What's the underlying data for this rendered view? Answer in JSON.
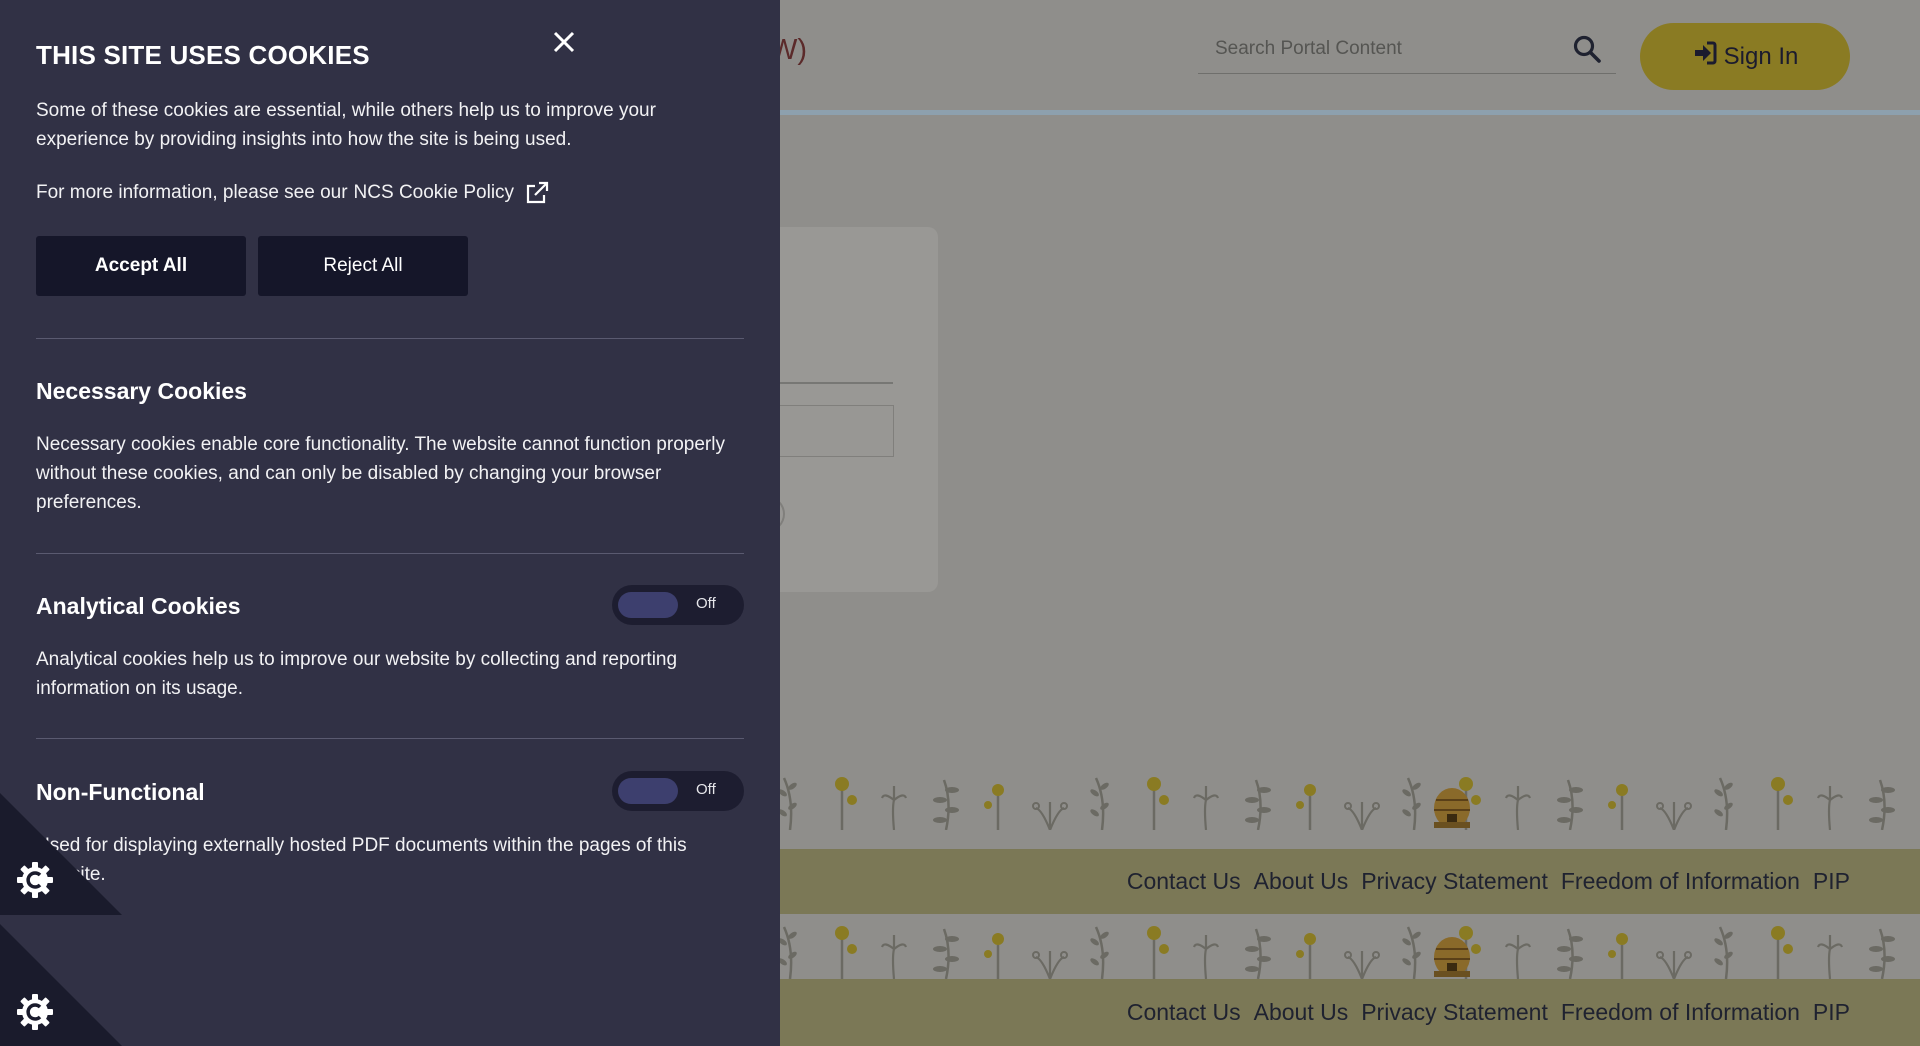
{
  "header": {
    "site_title_fragment": "W)",
    "search": {
      "placeholder": "Search Portal Content"
    },
    "sign_in_label": "Sign In"
  },
  "footer": {
    "links": [
      "Contact Us",
      "About Us",
      "Privacy Statement",
      "Freedom of Information",
      "PIP"
    ]
  },
  "cookie_panel": {
    "title": "THIS SITE USES COOKIES",
    "intro": "Some of these cookies are essential, while others help us to improve your experience by providing insights into how the site is being used.",
    "policy_prefix": "For more information, please see our",
    "policy_link": "NCS Cookie Policy",
    "accept_label": "Accept All",
    "reject_label": "Reject All",
    "sections": [
      {
        "title": "Necessary Cookies",
        "text": "Necessary cookies enable core functionality. The website cannot function properly without these cookies, and can only be disabled by changing your browser preferences."
      },
      {
        "title": "Analytical Cookies",
        "text": "Analytical cookies help us to improve our website by collecting and reporting information on its usage.",
        "toggle_label": "Off"
      },
      {
        "title": "Non-Functional",
        "text": "Used for displaying externally hosted PDF documents within the pages of this website.",
        "toggle_label": "Off"
      }
    ]
  },
  "colors": {
    "panel_bg": "#313145",
    "button_bg": "#151629",
    "sign_in_bg": "#8a7b23",
    "footer_bg": "#7b7856"
  },
  "icons": [
    "close-icon",
    "external-link-icon",
    "search-icon",
    "sign-in-icon",
    "cookie-settings-icon"
  ]
}
